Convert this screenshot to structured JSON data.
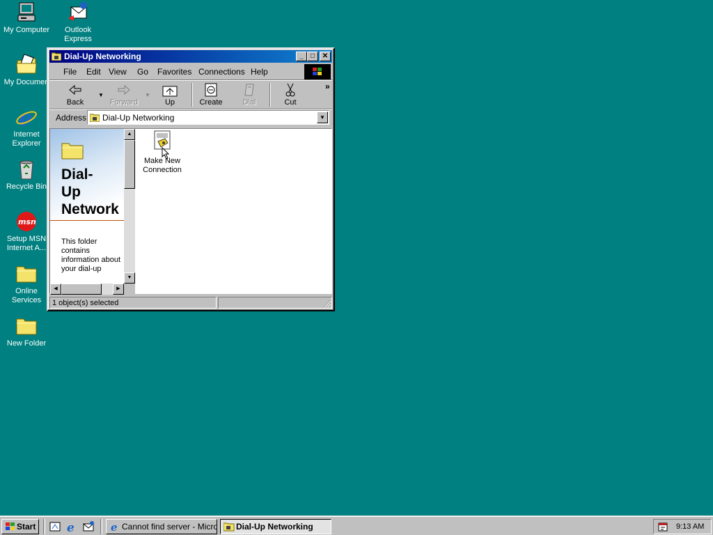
{
  "desktop": {
    "icons": [
      {
        "label": "My Computer",
        "icon": "computer-icon"
      },
      {
        "label": "Outlook Express",
        "label_line1": "Outlook",
        "label_line2": "Express",
        "icon": "outlook-express-icon"
      },
      {
        "label": "My Documen",
        "icon": "my-documents-folder-icon"
      },
      {
        "label": "Internet Explorer",
        "label_line1": "Internet",
        "label_line2": "Explorer",
        "icon": "internet-explorer-icon"
      },
      {
        "label": "Recycle Bin",
        "icon": "recycle-bin-icon"
      },
      {
        "label": "Setup MSN Internet A...",
        "label_line1": "Setup MSN",
        "label_line2": "Internet A...",
        "icon": "msn-icon"
      },
      {
        "label": "Online Services",
        "label_line1": "Online",
        "label_line2": "Services",
        "icon": "folder-icon"
      },
      {
        "label": "New Folder",
        "icon": "folder-icon"
      }
    ],
    "background_color": "#008080"
  },
  "window": {
    "title": "Dial-Up Networking",
    "menu": [
      "File",
      "Edit",
      "View",
      "Go",
      "Favorites",
      "Connections",
      "Help"
    ],
    "toolbar": {
      "back": "Back",
      "forward": "Forward",
      "up": "Up",
      "create": "Create",
      "dial": "Dial",
      "cut": "Cut",
      "more": "»"
    },
    "address": {
      "label": "Address",
      "value": "Dial-Up Networking"
    },
    "left_pane": {
      "title": "Dial-\nUp\nNetwork",
      "description": "This folder contains information about your dial-up"
    },
    "items": [
      {
        "label_line1": "Make New",
        "label_line2": "Connection",
        "label": "Make New Connection",
        "selected": true
      }
    ],
    "status": "1 object(s) selected"
  },
  "taskbar": {
    "start_label": "Start",
    "buttons": [
      {
        "label": "Cannot find server - Micros...",
        "active": false
      },
      {
        "label": "Dial-Up Networking",
        "active": true
      }
    ],
    "clock": "9:13 AM"
  }
}
